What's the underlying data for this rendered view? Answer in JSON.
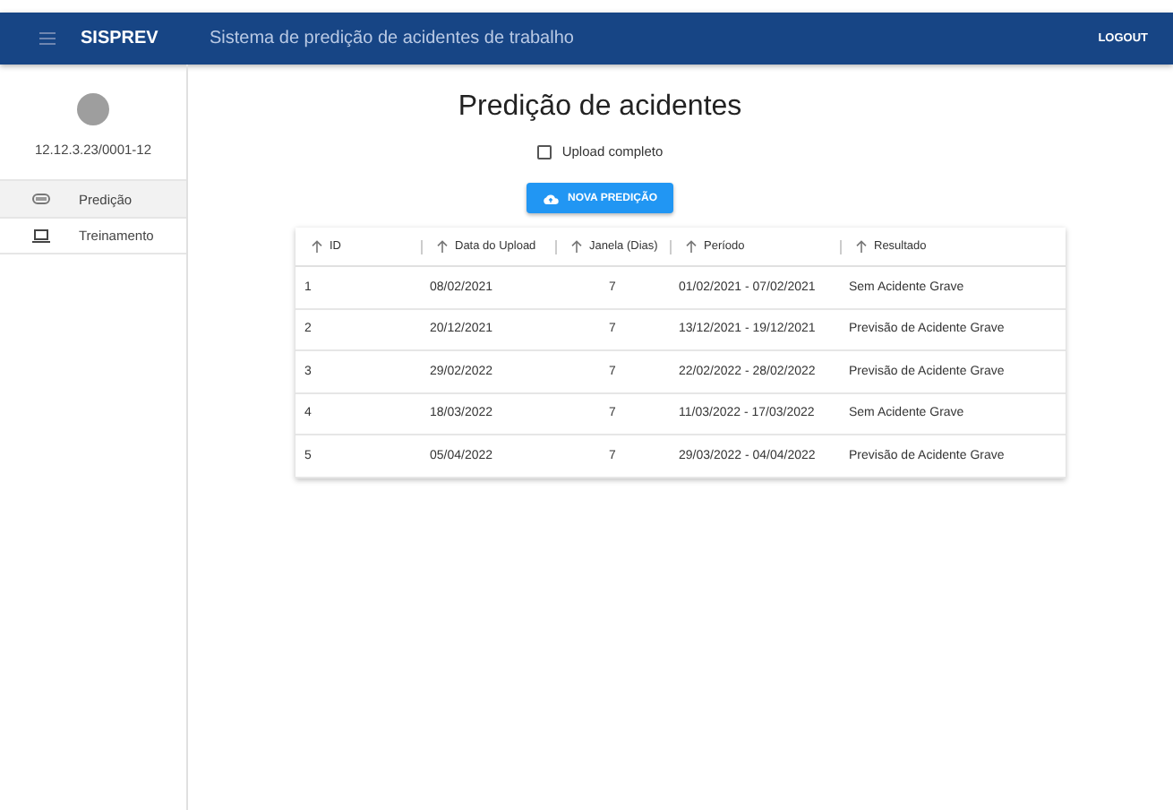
{
  "app_bar": {
    "brand": "SISPREV",
    "subtitle": "Sistema de predição de acidentes de trabalho",
    "logout": "LOGOUT"
  },
  "sidebar": {
    "user": "12.12.3.23/0001-12",
    "items": [
      {
        "label": "Predição",
        "kind": "capsule",
        "selected": true
      },
      {
        "label": "Treinamento",
        "kind": "laptop",
        "selected": false
      }
    ]
  },
  "title": "Predição de acidentes",
  "upload_checkbox": {
    "label": "Upload completo",
    "checked": false
  },
  "new_button": "NOVA PREDIÇÃO",
  "table": {
    "columns": [
      "ID",
      "Data do Upload",
      "Janela (Dias)",
      "Período",
      "Resultado"
    ],
    "rows": [
      [
        "1",
        "08/02/2021",
        "7",
        "01/02/2021 - 07/02/2021",
        "Sem Acidente Grave"
      ],
      [
        "2",
        "20/12/2021",
        "7",
        "13/12/2021 - 19/12/2021",
        "Previsão de Acidente Grave"
      ],
      [
        "3",
        "29/02/2022",
        "7",
        "22/02/2022 - 28/02/2022",
        "Previsão de Acidente Grave"
      ],
      [
        "4",
        "18/03/2022",
        "7",
        "11/03/2022 - 17/03/2022",
        "Sem Acidente Grave"
      ],
      [
        "5",
        "05/04/2022",
        "7",
        "29/03/2022 - 04/04/2022",
        "Previsão de Acidente Grave"
      ]
    ]
  }
}
